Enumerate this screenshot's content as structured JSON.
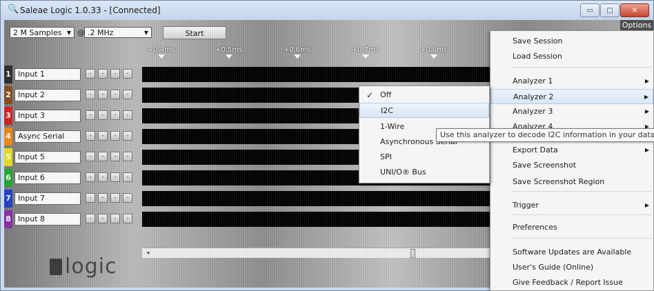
{
  "window": {
    "title": "Saleae Logic 1.0.33 - [Connected]",
    "controls": {
      "minimize": "▭",
      "maximize": "□",
      "close": "✕"
    }
  },
  "toolbar": {
    "samples_value": "2 M Samples",
    "at": "@",
    "rate_value": ".2 MHz",
    "start_label": "Start",
    "options_label": "Options"
  },
  "ruler": {
    "ticks": [
      "+0.4ms",
      "+0.5ms",
      "+0.6ms",
      "+0.7ms",
      "+0.8ms"
    ]
  },
  "channels": [
    {
      "num": "1",
      "name": "Input 1",
      "color": "#2b2b2b"
    },
    {
      "num": "2",
      "name": "Input 2",
      "color": "#8a4b1c"
    },
    {
      "num": "3",
      "name": "Input 3",
      "color": "#d42020"
    },
    {
      "num": "4",
      "name": "Async Serial",
      "color": "#f08a10"
    },
    {
      "num": "5",
      "name": "Input 5",
      "color": "#e8e020"
    },
    {
      "num": "6",
      "name": "Input 6",
      "color": "#22a832"
    },
    {
      "num": "7",
      "name": "Input 7",
      "color": "#2040c8"
    },
    {
      "num": "8",
      "name": "Input 8",
      "color": "#8a2aa8"
    }
  ],
  "mini_button_label": "-",
  "logo": {
    "text": "logic"
  },
  "options_menu": {
    "items": [
      {
        "label": "Save Session",
        "submenu": false
      },
      {
        "label": "Load Session",
        "submenu": false
      },
      {
        "label": "Analyzer 1",
        "submenu": true
      },
      {
        "label": "Analyzer 2",
        "submenu": true,
        "highlighted": true
      },
      {
        "label": "Analyzer 3",
        "submenu": true
      },
      {
        "label": "Analyzer 4",
        "submenu": true
      },
      {
        "label": "Export Data",
        "submenu": true
      },
      {
        "label": "Save Screenshot",
        "submenu": false
      },
      {
        "label": "Save Screenshot Region",
        "submenu": false
      },
      {
        "label": "Trigger",
        "submenu": true
      },
      {
        "label": "Preferences",
        "submenu": false
      },
      {
        "label": "Software Updates are Available",
        "submenu": false
      },
      {
        "label": "User's Guide (Online)",
        "submenu": false
      },
      {
        "label": "Give Feedback / Report Issue",
        "submenu": false
      }
    ],
    "submenu_arrow": "▶"
  },
  "analyzer_submenu": {
    "checkmark": "✓",
    "items": [
      {
        "label": "Off",
        "checked": true
      },
      {
        "label": "I2C",
        "highlighted": true
      },
      {
        "label": "1-Wire"
      },
      {
        "label": "Asynchronous Serial"
      },
      {
        "label": "SPI"
      },
      {
        "label": "UNI/O® Bus"
      }
    ]
  },
  "tooltip": {
    "text": "Use this analyzer to decode I2C information in your data."
  }
}
